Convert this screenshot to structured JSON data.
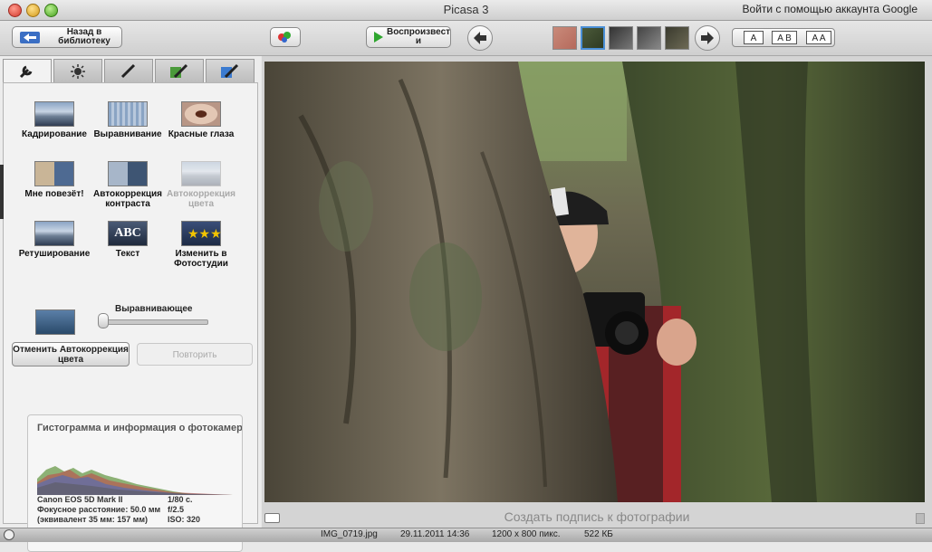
{
  "window": {
    "title": "Picasa 3",
    "signin": "Войти с помощью аккаунта Google"
  },
  "toolbar": {
    "back_label": "Назад в библиотеку",
    "play_label": "Воспроизвест и",
    "font_buttons": [
      "A",
      "A B",
      "A A"
    ]
  },
  "tabs": [
    {
      "icon": "wrench-icon"
    },
    {
      "icon": "sun-icon"
    },
    {
      "icon": "brush-icon"
    },
    {
      "icon": "green-brush-icon"
    },
    {
      "icon": "blue-brush-icon"
    }
  ],
  "tools": {
    "crop": "Кадрирование",
    "straighten": "Выравнивание",
    "redeye": "Красные глаза",
    "feeling_lucky": "Мне повезёт!",
    "auto_contrast": "Автокоррекция контраста",
    "auto_color": "Автокоррекция цвета",
    "retouch": "Ретуширование",
    "text": "Текст",
    "text_badge": "ABC",
    "edit_studio": "Изменить в Фотостудии",
    "fill_light": "Выравнивающее"
  },
  "actions": {
    "undo": "Отменить Автокоррекция цвета",
    "redo": "Повторить"
  },
  "histogram": {
    "title": "Гистограмма и информация о фотокамере",
    "camera": "Canon EOS 5D Mark II",
    "focal": "Фокусное расстояние: 50.0 мм",
    "equiv": "(эквивалент 35 мм: 157 мм)",
    "shutter": "1/80 с.",
    "aperture": "f/2.5",
    "iso": "ISO: 320"
  },
  "caption": {
    "placeholder": "Создать подпись к фотографии"
  },
  "status": {
    "filename": "IMG_0719.jpg",
    "datetime": "29.11.2011 14:36",
    "dimensions": "1200 x 800 пикс.",
    "filesize": "522 КБ"
  },
  "colors": {
    "accent": "#4a8fd6",
    "play_green": "#2ea52e"
  }
}
